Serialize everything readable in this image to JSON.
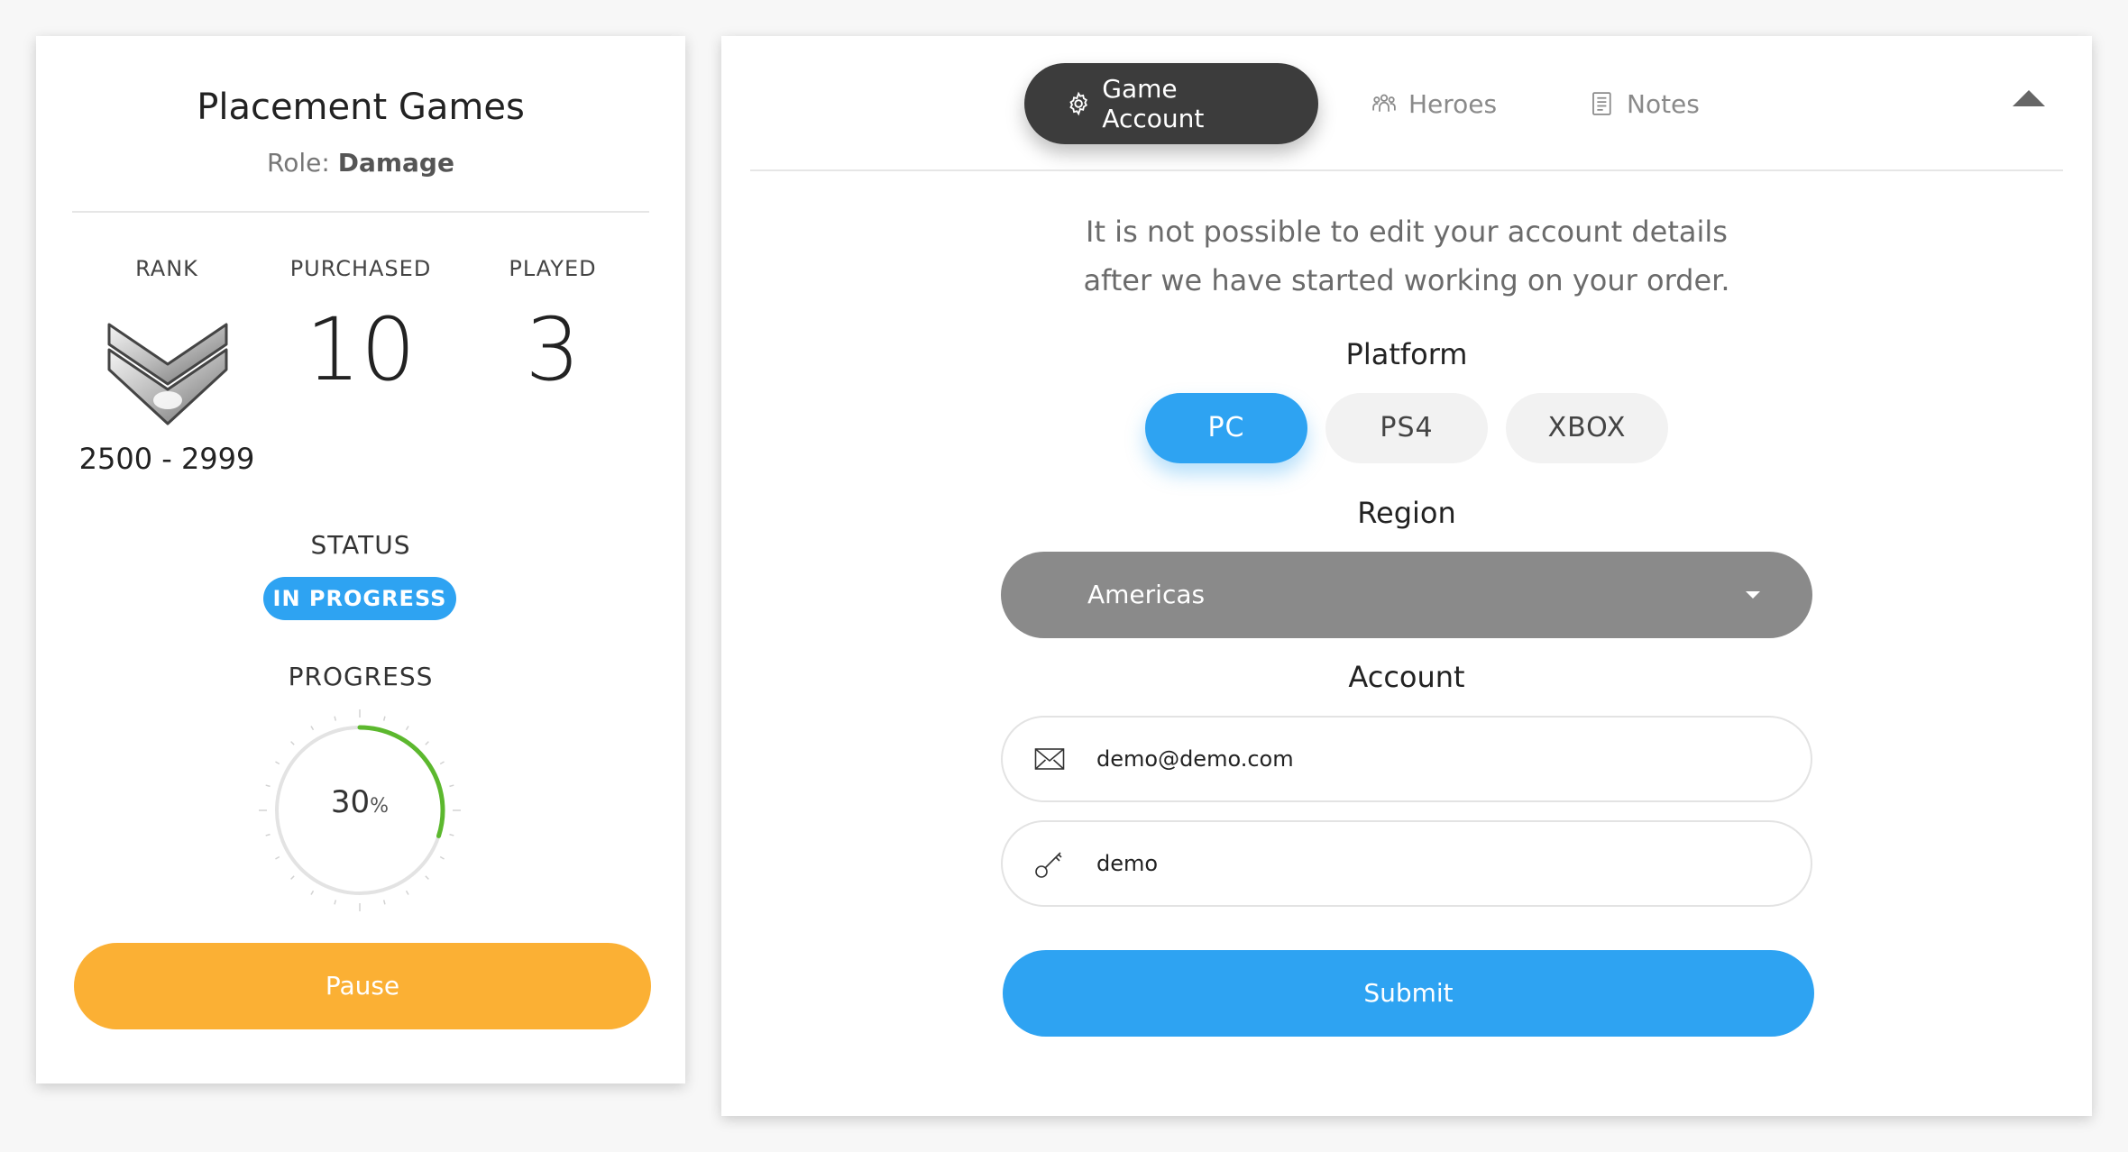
{
  "summary": {
    "title": "Placement Games",
    "role_label": "Role:",
    "role_value": "Damage",
    "stats": {
      "rank_label": "RANK",
      "purchased_label": "PURCHASED",
      "played_label": "PLAYED",
      "purchased_value": "10",
      "played_value": "3",
      "rank_range": "2500 - 2999"
    },
    "status_label": "STATUS",
    "status_value": "IN PROGRESS",
    "progress_label": "PROGRESS",
    "progress_value": "30",
    "progress_unit": "%",
    "progress_fraction": 0.3,
    "pause_label": "Pause"
  },
  "tabs": {
    "game_account": "Game Account",
    "heroes": "Heroes",
    "notes": "Notes"
  },
  "form": {
    "notice": "It is not possible to edit your account details after we have started working on your order.",
    "platform_label": "Platform",
    "platforms": [
      "PC",
      "PS4",
      "XBOX"
    ],
    "selected_platform": "PC",
    "region_label": "Region",
    "region_value": "Americas",
    "account_label": "Account",
    "email_value": "demo@demo.com",
    "password_value": "demo",
    "submit_label": "Submit"
  },
  "colors": {
    "accent_blue": "#2ea3f2",
    "pause_orange": "#fbb034",
    "progress_green": "#5cb82e",
    "dark_tab": "#3c3c3c"
  },
  "icons": {
    "game_account": "gear-icon",
    "heroes": "people-icon",
    "notes": "document-icon",
    "email": "envelope-icon",
    "password": "key-icon",
    "rank": "rank-chevron-badge",
    "region_select": "caret-down-icon",
    "collapse": "caret-up-icon"
  }
}
